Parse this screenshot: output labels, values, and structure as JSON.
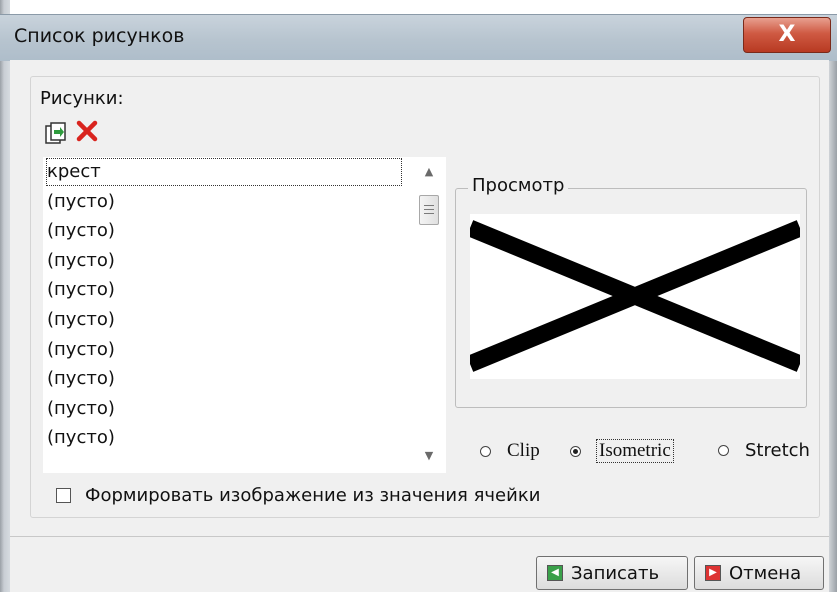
{
  "window": {
    "title": "Список рисунков",
    "close_label": "X"
  },
  "pictures": {
    "label": "Рисунки:",
    "items": [
      "крест",
      "(пусто)",
      "(пусто)",
      "(пусто)",
      "(пусто)",
      "(пусто)",
      "(пусто)",
      "(пусто)",
      "(пусто)",
      "(пусто)"
    ],
    "selected_index": 0
  },
  "toolbar": {
    "add_icon": "add-picture-icon",
    "delete_icon": "delete-icon"
  },
  "preview": {
    "legend": "Просмотр",
    "image_icon": "cross-image"
  },
  "scaling": {
    "options": [
      "Clip",
      "Isometric",
      "Stretch"
    ],
    "selected": "Isometric"
  },
  "cell_checkbox": {
    "label": "Формировать изображение из значения ячейки",
    "checked": false
  },
  "buttons": {
    "save_label": "Записать",
    "cancel_label": "Отмена"
  },
  "colors": {
    "accent_close": "#cf5a43",
    "delete_red": "#d9241e",
    "save_green": "#3aa04a"
  }
}
